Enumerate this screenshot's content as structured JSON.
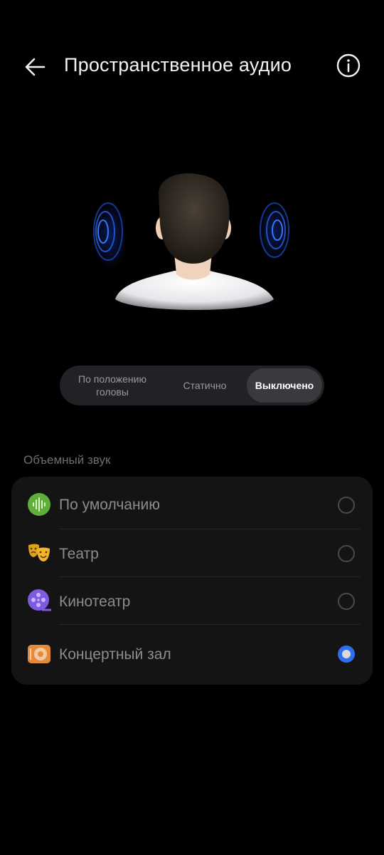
{
  "header": {
    "title": "Пространственное аудио",
    "back_icon": "arrow-left-icon",
    "info_icon": "info-icon"
  },
  "mode_selector": {
    "options": [
      {
        "label": "По положению головы"
      },
      {
        "label": "Статично"
      },
      {
        "label": "Выключено"
      }
    ],
    "selected": "Выключено"
  },
  "surround": {
    "section_label": "Объемный звук",
    "items": [
      {
        "label": "По умолчанию",
        "icon": "sound-wave-icon",
        "selected": false
      },
      {
        "label": "Театр",
        "icon": "theater-masks-icon",
        "selected": false
      },
      {
        "label": "Кинотеатр",
        "icon": "film-reel-icon",
        "selected": false
      },
      {
        "label": "Концертный зал",
        "icon": "concert-hall-icon",
        "selected": true
      }
    ]
  },
  "colors": {
    "background": "#000000",
    "accent": "#2d6ff0",
    "card": "#141414"
  }
}
